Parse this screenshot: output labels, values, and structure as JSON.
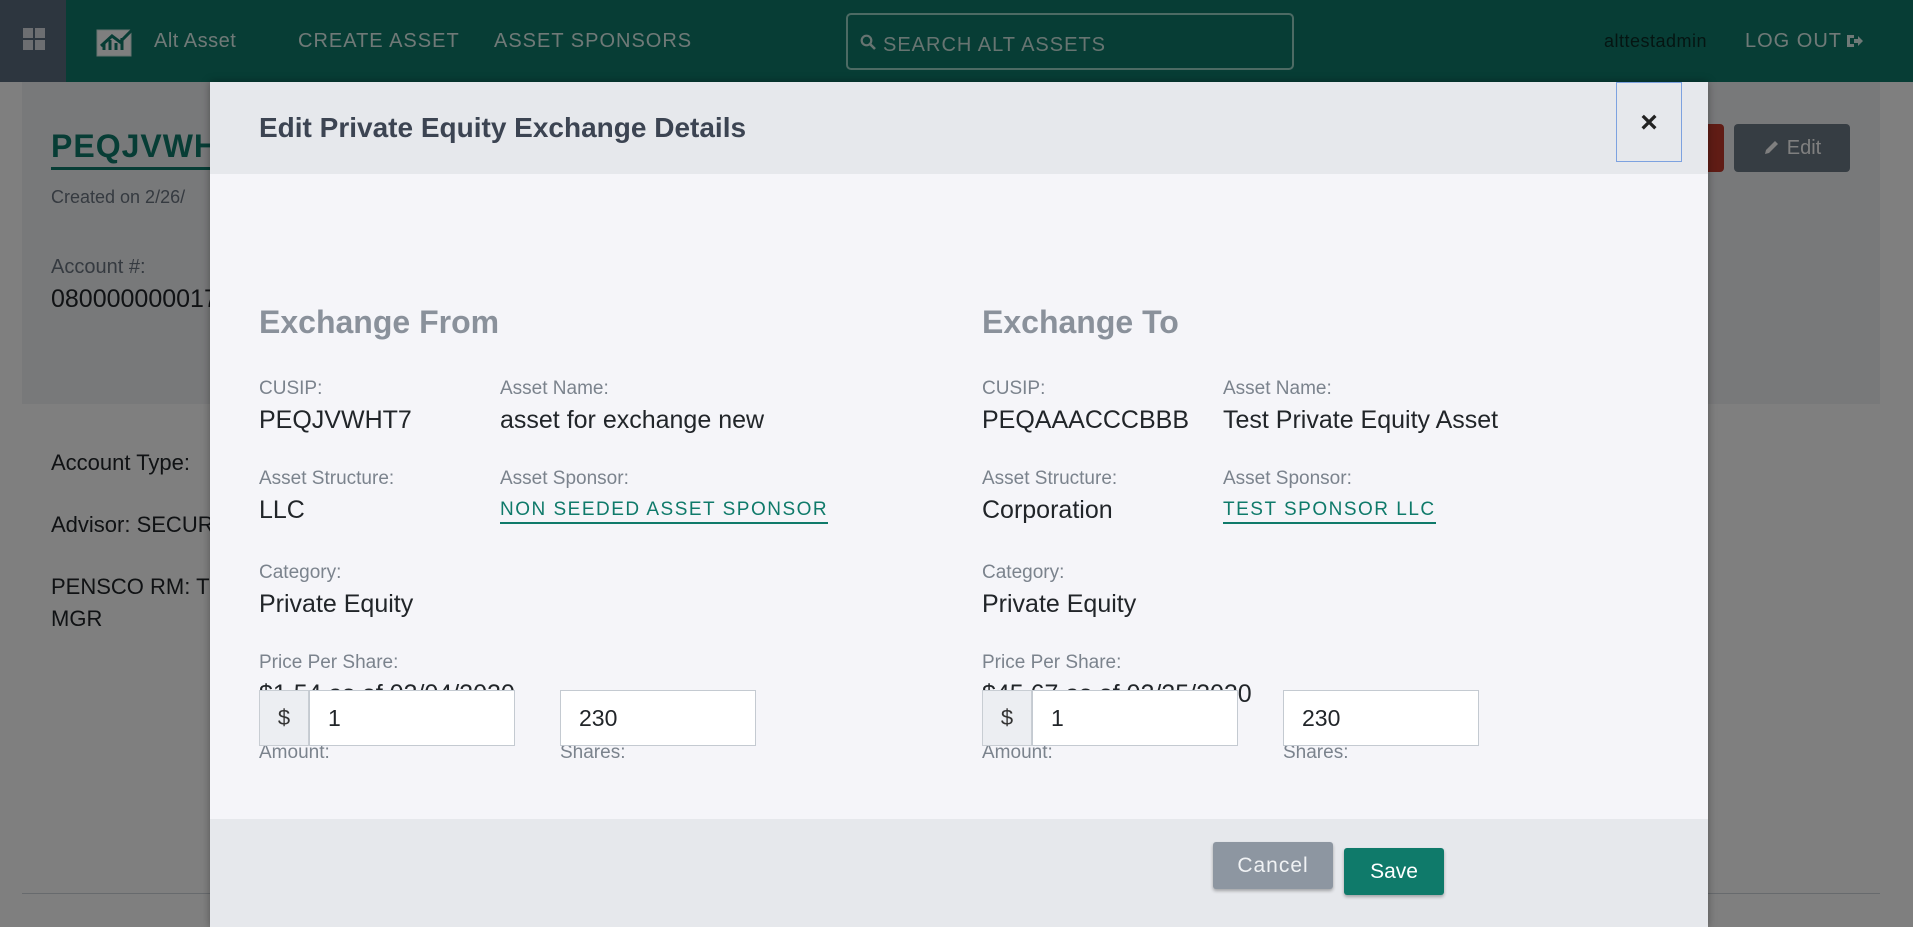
{
  "nav": {
    "brand": "Alt Asset",
    "links": [
      "CREATE ASSET",
      "ASSET SPONSORS"
    ],
    "search_placeholder": "SEARCH ALT ASSETS",
    "user": "alttestadmin",
    "logout": "LOG OUT"
  },
  "background": {
    "asset_title": "PEQJVWH",
    "created": "Created on 2/26/",
    "account_label": "Account #:",
    "account_value": "080000000017",
    "edit_label": "Edit",
    "account_type": "Account Type:",
    "advisor": "Advisor: SECUR",
    "pensco_rm_line1": "PENSCO RM: T",
    "pensco_rm_line2": "MGR"
  },
  "modal": {
    "title": "Edit Private Equity Exchange Details",
    "close": "×",
    "from": {
      "heading": "Exchange From",
      "cusip_label": "CUSIP:",
      "cusip": "PEQJVWHT7",
      "asset_name_label": "Asset Name:",
      "asset_name": "asset for exchange new",
      "structure_label": "Asset Structure:",
      "structure": "LLC",
      "sponsor_label": "Asset Sponsor:",
      "sponsor": "NON SEEDED ASSET SPONSOR",
      "category_label": "Category:",
      "category": "Private Equity",
      "price_label": "Price Per Share:",
      "price": "$1.54 as of 02/04/2020",
      "amount_label": "Amount:",
      "currency": "$",
      "amount": "1",
      "shares_label": "Shares:",
      "shares": "230"
    },
    "to": {
      "heading": "Exchange To",
      "cusip_label": "CUSIP:",
      "cusip": "PEQAAACCCBBB",
      "asset_name_label": "Asset Name:",
      "asset_name": "Test Private Equity Asset",
      "structure_label": "Asset Structure:",
      "structure": "Corporation",
      "sponsor_label": "Asset Sponsor:",
      "sponsor": "TEST SPONSOR LLC",
      "category_label": "Category:",
      "category": "Private Equity",
      "price_label": "Price Per Share:",
      "price": "$45.67 as of 02/25/2020",
      "amount_label": "Amount:",
      "currency": "$",
      "amount": "1",
      "shares_label": "Shares:",
      "shares": "230"
    },
    "cancel": "Cancel",
    "save": "Save"
  },
  "colors": {
    "brand": "#0f7a6a",
    "apps_tile": "#5a6c7e",
    "cancel": "#8d96a1",
    "danger": "#c0392b"
  },
  "icons": [
    "apps-grid-icon",
    "alt-asset-logo-icon",
    "search-icon",
    "logout-icon",
    "pencil-icon",
    "close-icon"
  ]
}
